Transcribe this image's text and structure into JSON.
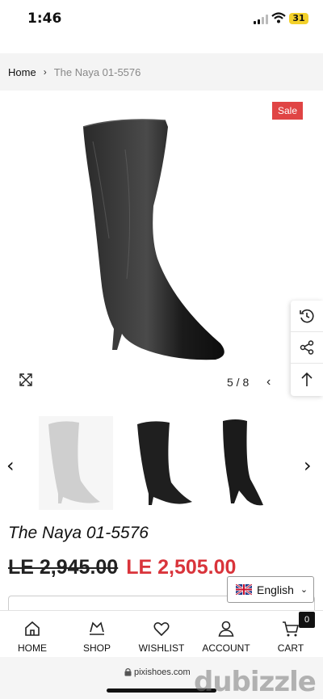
{
  "status_bar": {
    "time": "1:46",
    "battery": "31"
  },
  "breadcrumb": {
    "home": "Home",
    "separator": "›",
    "current": "The Naya 01-5576"
  },
  "gallery": {
    "sale_badge": "Sale",
    "counter": "5 / 8",
    "prev_glyph": "‹"
  },
  "thumbnails": {
    "prev_glyph": "‹",
    "next_glyph": "›"
  },
  "product": {
    "title": "The Naya 01-5576",
    "price_old": "LE 2,945.00",
    "price_new": "LE 2,505.00"
  },
  "language": {
    "selected": "English",
    "chevron": "⌄"
  },
  "bottom_nav": {
    "items": [
      {
        "label": "HOME"
      },
      {
        "label": "SHOP"
      },
      {
        "label": "WISHLIST"
      },
      {
        "label": "ACCOUNT"
      },
      {
        "label": "CART"
      }
    ],
    "cart_count": "0"
  },
  "browser": {
    "url": "pixishoes.com"
  },
  "watermark": "dubizzle",
  "colors": {
    "sale": "#e04444",
    "price_new": "#d9343b",
    "battery": "#f3d12b"
  },
  "icons": {
    "expand": "expand-icon",
    "history": "history-icon",
    "share": "share-icon",
    "top": "arrow-up-icon",
    "home": "home-icon",
    "shop": "shop-icon",
    "wishlist": "heart-icon",
    "account": "user-icon",
    "cart": "cart-icon"
  }
}
